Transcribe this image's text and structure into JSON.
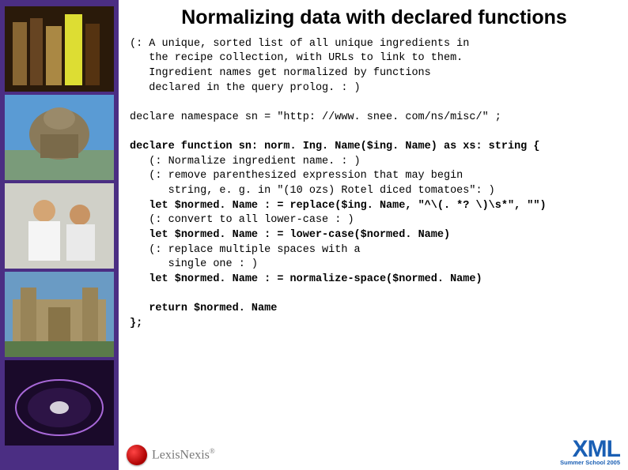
{
  "title": "Normalizing data with declared functions",
  "code_lines": [
    "(: A unique, sorted list of all unique ingredients in",
    "   the recipe collection, with URLs to link to them.",
    "   Ingredient names get normalized by functions",
    "   declared in the query prolog. : )",
    "",
    "declare namespace sn = \"http: //www. snee. com/ns/misc/\" ;",
    "",
    "<b>declare function sn: norm. Ing. Name($ing. Name) as xs: string {</b>",
    "   (: Normalize ingredient name. : )",
    "   (: remove parenthesized expression that may begin",
    "      string, e. g. in \"(10 ozs) Rotel diced tomatoes\": )",
    "   <b>let $normed. Name : = replace($ing. Name, \"^\\(. *? \\)\\s*\", \"\")</b>",
    "   (: convert to all lower-case : )",
    "   <b>let $normed. Name : = lower-case($normed. Name)</b>",
    "   (: replace multiple spaces with a",
    "      single one : )",
    "   <b>let $normed. Name : = normalize-space($normed. Name)</b>",
    "",
    "   <b>return $normed. Name</b>",
    "<b>};</b>"
  ],
  "footer": {
    "lexis": "LexisNexis",
    "xml": "XML",
    "xml_sub": "Summer School 2005"
  },
  "sidebar_thumbs": [
    "books",
    "dome-building",
    "doctors",
    "oxford-building",
    "disc"
  ]
}
